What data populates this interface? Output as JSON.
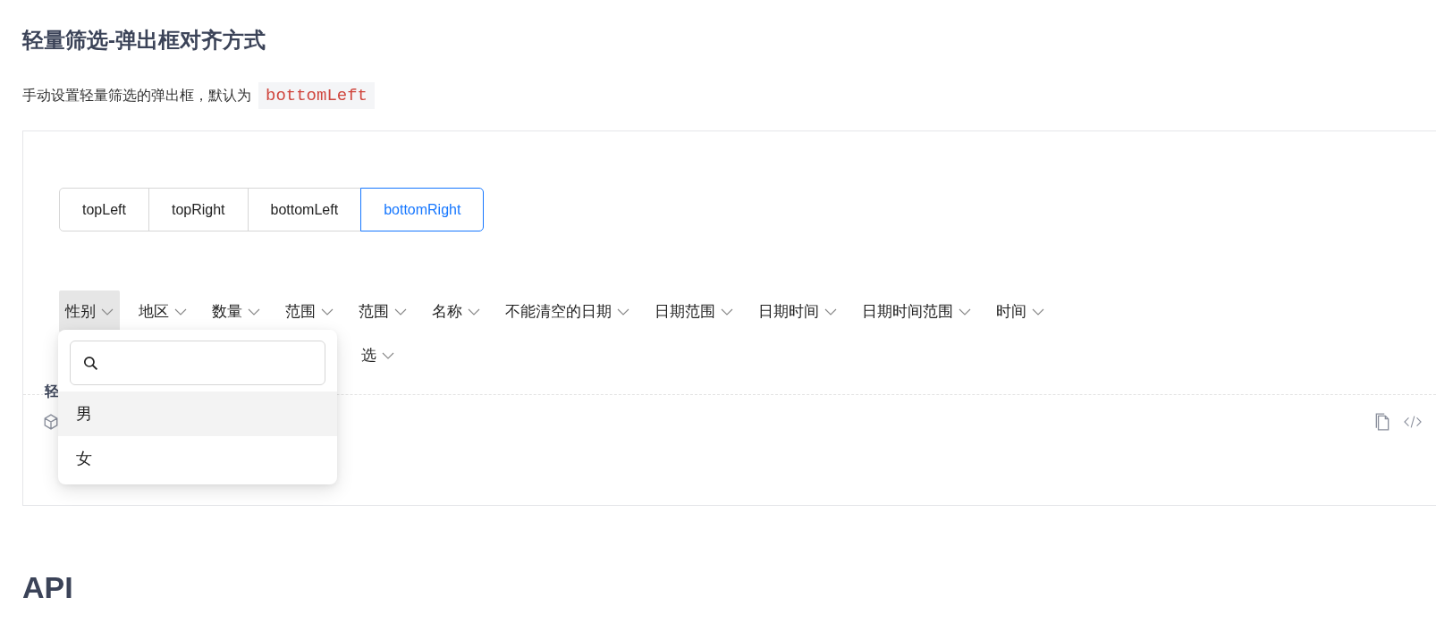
{
  "title": "轻量筛选-弹出框对齐方式",
  "description": {
    "text": "手动设置轻量筛选的弹出框，默认为",
    "code": "bottomLeft"
  },
  "placement_buttons": [
    {
      "label": "topLeft",
      "selected": false
    },
    {
      "label": "topRight",
      "selected": false
    },
    {
      "label": "bottomLeft",
      "selected": false
    },
    {
      "label": "bottomRight",
      "selected": true
    }
  ],
  "filters": [
    {
      "label": "性别",
      "selected": true
    },
    {
      "label": "地区",
      "selected": false
    },
    {
      "label": "数量",
      "selected": false
    },
    {
      "label": "范围",
      "selected": false
    },
    {
      "label": "范围",
      "selected": false
    },
    {
      "label": "名称",
      "selected": false
    },
    {
      "label": "不能清空的日期",
      "selected": false
    },
    {
      "label": "日期范围",
      "selected": false
    },
    {
      "label": "日期时间",
      "selected": false
    },
    {
      "label": "日期时间范围",
      "selected": false
    },
    {
      "label": "时间",
      "selected": false
    }
  ],
  "filters_row_2": [
    {
      "label": "选",
      "selected": false
    }
  ],
  "dropdown": {
    "options": [
      {
        "label": "男",
        "selected": true
      },
      {
        "label": "女",
        "selected": false
      }
    ]
  },
  "demo_meta": {
    "title": "轻"
  },
  "api_heading": "API"
}
